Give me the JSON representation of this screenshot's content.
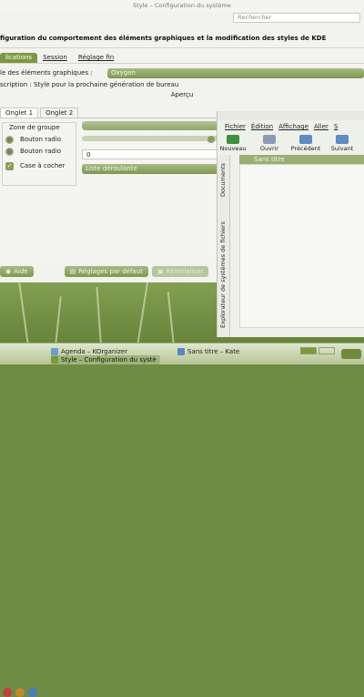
{
  "window": {
    "title": "Style – Configuration du système"
  },
  "search": {
    "placeholder": "Rechercher"
  },
  "heading": "figuration du comportement des éléments graphiques et la modification des styles de KDE",
  "tabs": [
    {
      "label": "lications",
      "active": true
    },
    {
      "label": "Session"
    },
    {
      "label": "Réglage fin"
    }
  ],
  "style_row": {
    "label": "le des éléments graphiques :",
    "value": "Oxygen"
  },
  "description": {
    "text": "scription : Style pour la prochaine génération de bureau"
  },
  "preview": {
    "title": "Aperçu"
  },
  "subtabs": [
    {
      "label": "Onglet 1",
      "active": true
    },
    {
      "label": "Onglet 2"
    }
  ],
  "group": {
    "title": "Zone de groupe",
    "radio1": "Bouton radio",
    "radio2": "Bouton radio",
    "checkbox": "Case à cocher"
  },
  "spin": {
    "value": "0"
  },
  "dropdown": {
    "value": "Liste déroulante"
  },
  "buttons": {
    "help": "Aide",
    "defaults": "Réglages par défaut",
    "reset": "Réinitialiser"
  },
  "kate": {
    "menu": [
      "Fichier",
      "Édition",
      "Affichage",
      "Aller",
      "S"
    ],
    "toolbar": [
      "Nouveau",
      "Ouvrir",
      "Précédent",
      "Suivant"
    ],
    "side_tabs": [
      "Documents",
      "Explorateur de systèmes de fichiers"
    ],
    "doc_title": "Sans titre"
  },
  "taskbar": {
    "tasks": [
      "Agenda – KOrganizer",
      "Sans titre – Kate",
      "Style – Configuration du systè"
    ]
  },
  "colors": {
    "accent": "#7c9840",
    "window_bg": "#f2f2ef"
  }
}
